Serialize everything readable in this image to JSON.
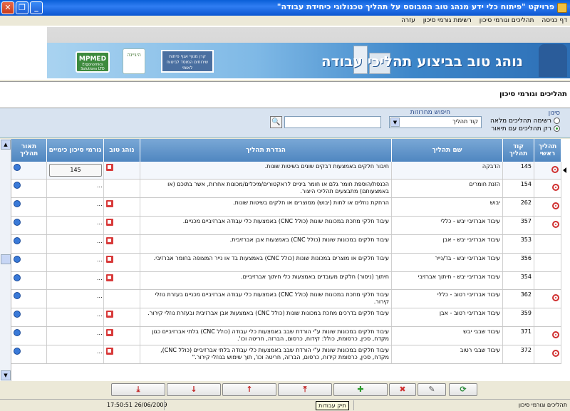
{
  "window": {
    "title": "פרויקט \"פיתוח כלי ידע מנהג טוב המבוסס על תהליך טכנולוגי כיחידת עבודה\"",
    "controls": {
      "close": "✕",
      "restore": "❐",
      "minimize": "_"
    }
  },
  "menu": [
    "דף כניסה",
    "תהליכים וגורמי סיכון",
    "רשימת גורמי סיכון",
    "עזרה"
  ],
  "banner": {
    "slogan": "נוהג טוב בביצוע תהליכי עבודה",
    "logos": {
      "mpmed": "MPMED",
      "mpmed_sub": "Ergonomics Solutions LTD",
      "circle": "היגיינה",
      "fund": "קרן מנוף אגף פיתוח שירותים המוסד לביטוח לאומי"
    }
  },
  "section_title": "תהליכים וגורמי סיכון",
  "filter": {
    "label": "סינון",
    "options": [
      {
        "label": "רשימה תהליכים מלאה",
        "checked": false
      },
      {
        "label": "רק תהליכים עם תיאור",
        "checked": true
      }
    ],
    "search_label": "חיפוש מחרוזות",
    "select_value": "קוד תהליך",
    "search_value": "",
    "search_icon": "🔍"
  },
  "columns": [
    "תהליך ראשי",
    "קוד תהליך",
    "שם תהליך",
    "הגדרת תהליך",
    "נוהג טוב",
    "גורמי סיכון כימיים",
    "תאור תהליך"
  ],
  "rows": [
    {
      "code": "145",
      "name": "הדבקה",
      "def": "חיבור חלקים באמצעות דבקים שונים בשיטות שונות.",
      "main": true,
      "gp": true,
      "chem": "145",
      "chem_button": true
    },
    {
      "code": "154",
      "name": "הזנת חומרים",
      "def": "הכנסת/הוספת חומר גלם או חומר ביניים לראקטורים/מיכלים/מכונות אחרות, אשר בתוכם (או באמצעותם) מתבצעים תהליכי היצור.",
      "main": true,
      "gp": false,
      "chem": "...",
      "chem_button": false
    },
    {
      "code": "262",
      "name": "יבוש",
      "def": "הרחקת נוזלים או לחות (יבוש) ממוצרים או חלקים בשיטות שונות.",
      "main": true,
      "gp": true,
      "chem": "...",
      "chem_button": false
    },
    {
      "code": "357",
      "name": "עיבוד אברזיבי יבש - כללי",
      "def": "עיבוד חלקי מתכת במכונות שונות (כולל CNC) באמצעות כלי עבודה אברזיביים מכניים.",
      "main": true,
      "gp": true,
      "chem": "...",
      "chem_button": false
    },
    {
      "code": "353",
      "name": "עיבוד אברזיבי יבש - אבן",
      "def": "עיבוד חלקים במכונות שונות (כולל CNC) באמצעות אבן אברזיבית.",
      "main": false,
      "gp": true,
      "chem": "...",
      "chem_button": false
    },
    {
      "code": "356",
      "name": "עיבוד אברזיבי יבש - בד/נייר",
      "def": "עיבוד חלקים או מוצרים במכונות שונות (כולל CNC) באמצעות בד או נייר המצופה בחומר אברזיבי.",
      "main": false,
      "gp": true,
      "chem": "...",
      "chem_button": false
    },
    {
      "code": "354",
      "name": "עיבוד אברזיבי יבש - חיתוך אברזיבי",
      "def": "חיתוך (ניסור) חלקים מעובדים באמצעות כלי חיתוך אברזיביים.",
      "main": false,
      "gp": true,
      "chem": "...",
      "chem_button": false
    },
    {
      "code": "362",
      "name": "עיבוד אברזיבי רטוב - כללי",
      "def": "עיבוד חלקי מתכת במכונות שונות (כולל CNC) באמצעות כלי עבודה אברזיביים מכניים בעזרת נוזלי קירור.",
      "main": true,
      "gp": false,
      "chem": "...",
      "chem_button": false
    },
    {
      "code": "359",
      "name": "עיבוד אברזיבי רטוב - אבן",
      "def": "עיבוד חלקים בדרכים מחכת במכונות שונות (כולל CNC) באמצעות אבן אברזיבית ובעזרת נוזלי קירור.",
      "main": false,
      "gp": true,
      "chem": "...",
      "chem_button": false
    },
    {
      "code": "371",
      "name": "עיבוד שבבי יבש",
      "def": "עיבוד חלקים במכונות שונות ע\"י הורדת שבב באמצעות כלי עבודה (כולל CNC) בלתי אברזיביים כגון מקדח, סכין, כרסומת, כולל: קידוח, כרסום, הברזה, חריטה וכו'.",
      "main": true,
      "gp": true,
      "chem": "...",
      "chem_button": false
    },
    {
      "code": "372",
      "name": "עיבוד שבבי רטוב",
      "def": "עיבוד חלקים במכונות שונות ע\"י הורדת שבב באמצעות כלי עבודה בלתי אברזיביים (כולל CNC), מקדח, סכין, כרסומת קידוח, כרסום, הברזה, חריטה וכו', תוך שימוש בנוזלי קירור.\"",
      "main": true,
      "gp": true,
      "chem": "...",
      "chem_button": false
    }
  ],
  "toolbar": {
    "buttons": [
      {
        "name": "move-last-button",
        "glyph": "⤓",
        "color": "#c02020"
      },
      {
        "name": "move-next-button",
        "glyph": "↓",
        "color": "#c02020"
      },
      {
        "name": "move-prev-button",
        "glyph": "↑",
        "color": "#c02020"
      },
      {
        "name": "move-first-button",
        "glyph": "⤒",
        "color": "#c02020"
      },
      {
        "name": "add-button",
        "glyph": "✚",
        "color": "#2a9a2a"
      },
      {
        "name": "delete-button",
        "glyph": "✖",
        "color": "#d03030"
      },
      {
        "name": "edit-button",
        "glyph": "✎",
        "color": "#555555"
      },
      {
        "name": "refresh-button",
        "glyph": "⟳",
        "color": "#2a8a3a"
      }
    ],
    "tooltip": "תיק עבודות"
  },
  "status": {
    "datetime": "17:50:51 26/06/2009",
    "form_name": "תהליכים וגורמי סיכון"
  }
}
